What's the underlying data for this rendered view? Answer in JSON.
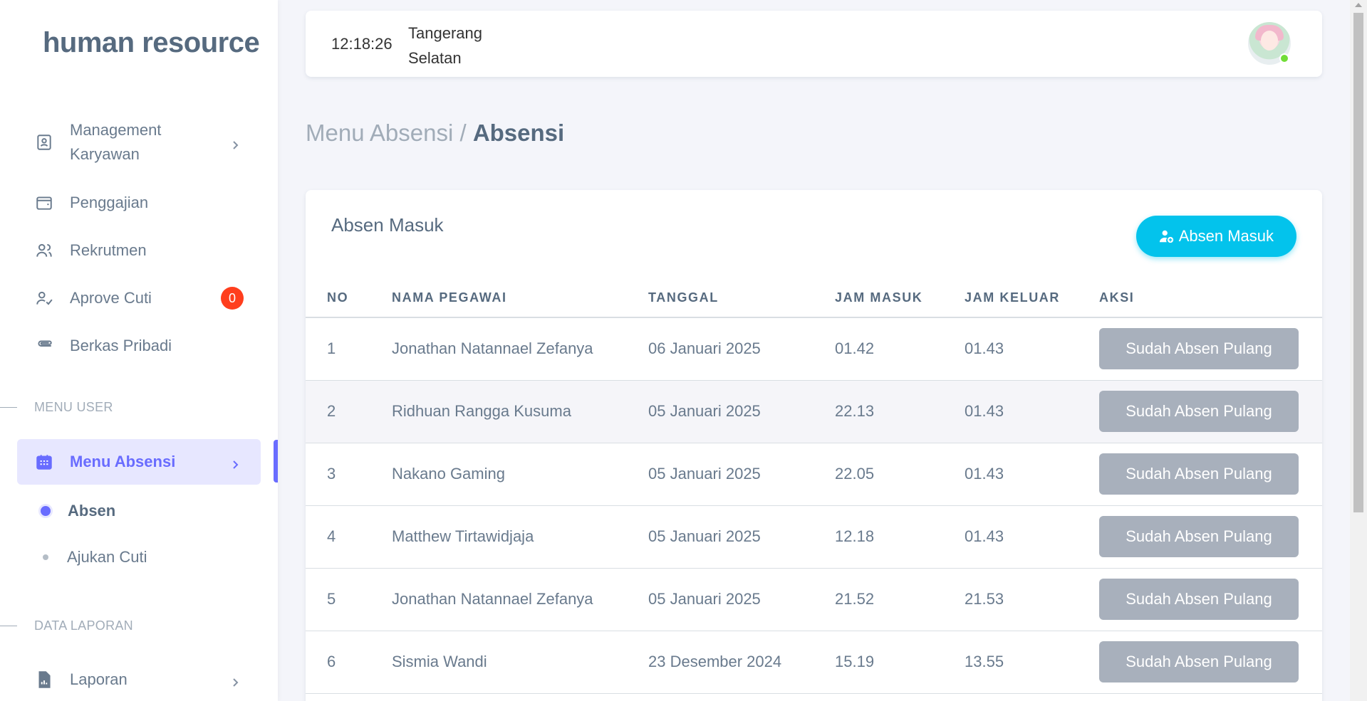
{
  "app": {
    "brand": "human resource"
  },
  "sidebar": {
    "items": [
      {
        "label": "Management Karyawan",
        "icon": "id-card-icon"
      },
      {
        "label": "Penggajian",
        "icon": "wallet-icon"
      },
      {
        "label": "Rekrutmen",
        "icon": "users-icon"
      },
      {
        "label": "Aprove Cuti",
        "icon": "user-check-icon",
        "badge": "0"
      },
      {
        "label": "Berkas Pribadi",
        "icon": "paperclip-icon"
      }
    ],
    "section_user": "MENU USER",
    "menu_absensi": {
      "label": "Menu Absensi",
      "icon": "calendar-icon"
    },
    "sub_items": [
      "Absen",
      "Ajukan Cuti"
    ],
    "section_laporan": "DATA LAPORAN",
    "laporan": {
      "label": "Laporan",
      "icon": "file-chart-icon"
    }
  },
  "navbar": {
    "time": "12:18:26",
    "location": "Tangerang Selatan"
  },
  "breadcrumb": {
    "parent": "Menu Absensi /",
    "current": "Absensi"
  },
  "card": {
    "title": "Absen Masuk",
    "button_label": "Absen Masuk",
    "columns": [
      "NO",
      "NAMA PEGAWAI",
      "TANGGAL",
      "JAM MASUK",
      "JAM KELUAR",
      "AKSI"
    ],
    "rows": [
      {
        "no": "1",
        "nama": "Jonathan Natannael Zefanya",
        "tanggal": "06 Januari 2025",
        "masuk": "01.42",
        "keluar": "01.43",
        "aksi": "Sudah Absen Pulang"
      },
      {
        "no": "2",
        "nama": "Ridhuan Rangga Kusuma",
        "tanggal": "05 Januari 2025",
        "masuk": "22.13",
        "keluar": "01.43",
        "aksi": "Sudah Absen Pulang"
      },
      {
        "no": "3",
        "nama": "Nakano Gaming",
        "tanggal": "05 Januari 2025",
        "masuk": "22.05",
        "keluar": "01.43",
        "aksi": "Sudah Absen Pulang"
      },
      {
        "no": "4",
        "nama": "Matthew Tirtawidjaja",
        "tanggal": "05 Januari 2025",
        "masuk": "12.18",
        "keluar": "01.43",
        "aksi": "Sudah Absen Pulang"
      },
      {
        "no": "5",
        "nama": "Jonathan Natannael Zefanya",
        "tanggal": "05 Januari 2025",
        "masuk": "21.52",
        "keluar": "21.53",
        "aksi": "Sudah Absen Pulang"
      },
      {
        "no": "6",
        "nama": "Sismia Wandi",
        "tanggal": "23 Desember 2024",
        "masuk": "15.19",
        "keluar": "13.55",
        "aksi": "Sudah Absen Pulang"
      }
    ]
  },
  "colors": {
    "primary": "#696cff",
    "info": "#03c3ec",
    "danger": "#ff3e1d",
    "disabled": "#a8b0bc"
  }
}
